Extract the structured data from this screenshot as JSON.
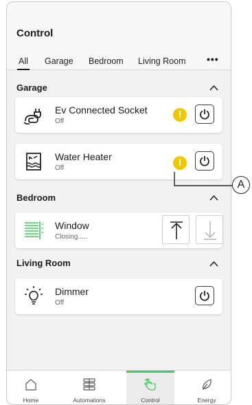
{
  "header": {
    "title": "Control",
    "tabs": [
      {
        "label": "All",
        "active": true
      },
      {
        "label": "Garage"
      },
      {
        "label": "Bedroom"
      },
      {
        "label": "Living Room"
      }
    ],
    "more_label": "•••"
  },
  "sections": [
    {
      "title": "Garage",
      "devices": [
        {
          "name": "Ev Connected Socket",
          "status": "Off",
          "icon": "ev-socket-icon",
          "warning": true,
          "control": "power"
        },
        {
          "name": "Water Heater",
          "status": "Off",
          "icon": "water-heater-icon",
          "warning": true,
          "control": "power"
        }
      ]
    },
    {
      "title": "Bedroom",
      "devices": [
        {
          "name": "Window",
          "status": "Closing.....",
          "icon": "window-blind-icon",
          "control": "open-close"
        }
      ]
    },
    {
      "title": "Living Room",
      "devices": [
        {
          "name": "Dimmer",
          "status": "Off",
          "icon": "dimmer-bulb-icon",
          "control": "power"
        }
      ]
    }
  ],
  "warning_glyph": "!",
  "bottom_nav": [
    {
      "label": "Home",
      "icon": "home-icon"
    },
    {
      "label": "Automations",
      "icon": "automations-icon"
    },
    {
      "label": "Control",
      "icon": "control-hand-icon",
      "active": true
    },
    {
      "label": "Energy",
      "icon": "energy-leaf-icon"
    }
  ],
  "callout": {
    "label": "A"
  },
  "colors": {
    "accent": "#3dcd58",
    "warning": "#f0c800"
  }
}
